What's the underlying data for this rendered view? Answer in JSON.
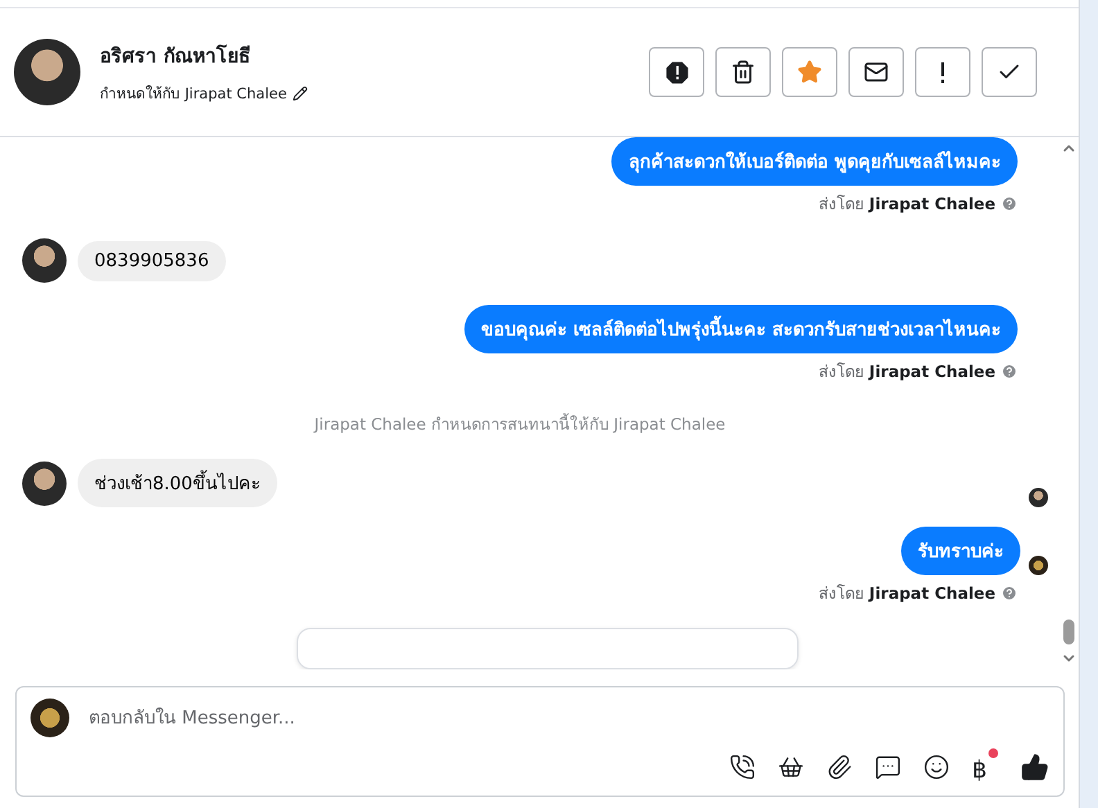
{
  "contact": {
    "name": "อริศรา กัณหาโยธี",
    "assigned": "กำหนดให้กับ Jirapat Chalee"
  },
  "actions": [
    {
      "kind": "spam"
    },
    {
      "kind": "delete"
    },
    {
      "kind": "star"
    },
    {
      "kind": "unread"
    },
    {
      "kind": "alert"
    },
    {
      "kind": "done"
    }
  ],
  "messages": [
    {
      "kind": "outgoing",
      "text": "ลุกค้าสะดวกให้เบอร์ติดต่อ พูดคุยกับเซลล์ไหมคะ",
      "note": "ส่งโดย **Jirapat Chalee**",
      "page_avatar": false
    },
    {
      "kind": "incoming",
      "text": "0839905836"
    },
    {
      "kind": "outgoing",
      "text": "ขอบคุณค่ะ เซลล์ติดต่อไปพรุ่งนี้นะคะ สะดวกรับสายช่วงเวลาไหนคะ",
      "note": "ส่งโดย **Jirapat Chalee**",
      "page_avatar": false
    },
    {
      "kind": "system",
      "text": "Jirapat Chalee กำหนดการสนทนานี้ให้กับ Jirapat Chalee"
    },
    {
      "kind": "incoming",
      "text": "ช่วงเช้า8.00ขึ้นไปคะ"
    },
    {
      "kind": "read_receipt"
    },
    {
      "kind": "outgoing",
      "text": "รับทราบค่ะ",
      "note": "ส่งโดย **Jirapat Chalee**",
      "page_avatar": true
    },
    {
      "kind": "card"
    }
  ],
  "composer": {
    "placeholder": "ตอบกลับใน Messenger...",
    "currency": "฿",
    "currency_badge": true
  }
}
